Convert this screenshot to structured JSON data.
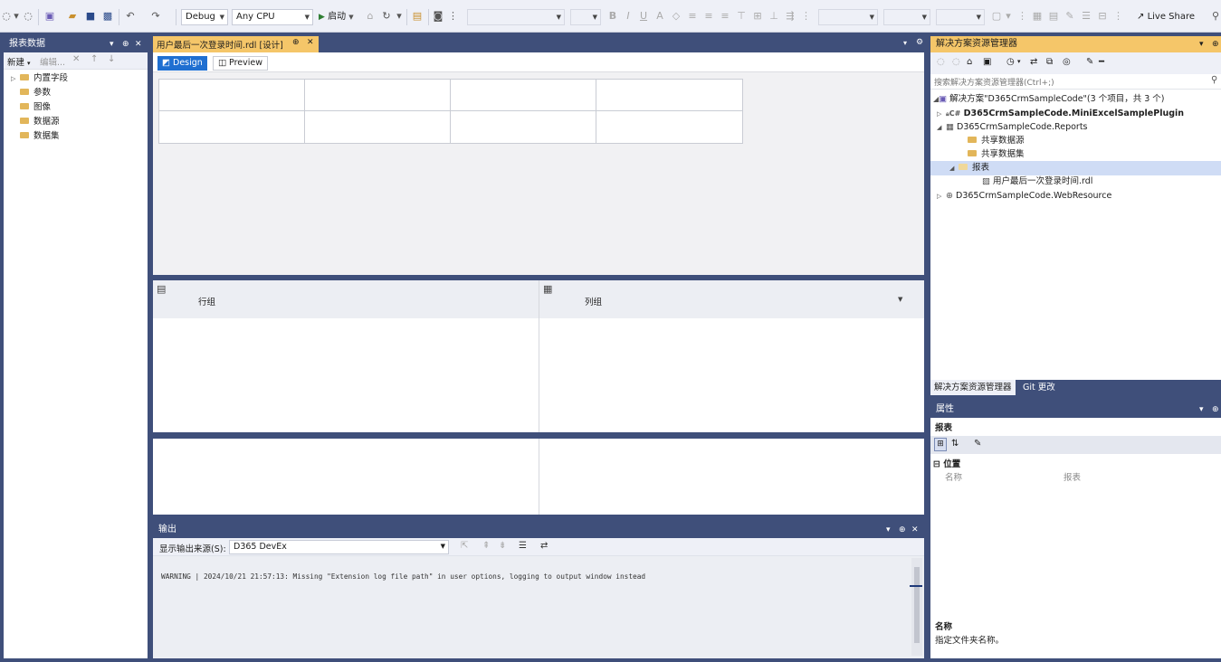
{
  "toolbar": {
    "config_value": "Debug",
    "platform_value": "Any CPU",
    "start_label": "启动",
    "live_share_label": "Live Share"
  },
  "report_data_panel": {
    "title": "报表数据",
    "new_label": "新建",
    "edit_label": "编辑...",
    "items": [
      {
        "label": "内置字段",
        "expandable": true
      },
      {
        "label": "参数",
        "expandable": false
      },
      {
        "label": "图像",
        "expandable": false
      },
      {
        "label": "数据源",
        "expandable": false
      },
      {
        "label": "数据集",
        "expandable": false
      }
    ]
  },
  "document": {
    "tab_title": "用户最后一次登录时间.rdl [设计]",
    "design_tab": "Design",
    "preview_tab": "Preview",
    "row_groups_label": "行组",
    "col_groups_label": "列组"
  },
  "output_panel": {
    "title": "输出",
    "source_label": "显示输出来源(S):",
    "source_value": "D365 DevEx",
    "log_line": "WARNING | 2024/10/21 21:57:13: Missing \"Extension log file path\" in user options, logging to output window instead"
  },
  "solution_explorer": {
    "title": "解决方案资源管理器",
    "search_placeholder": "搜索解决方案资源管理器(Ctrl+;)",
    "solution_label": "解决方案\"D365CrmSampleCode\"(3 个项目，共 3 个)",
    "project1": "D365CrmSampleCode.MiniExcelSamplePlugin",
    "project2": "D365CrmSampleCode.Reports",
    "shared_ds": "共享数据源",
    "shared_dataset": "共享数据集",
    "reports_folder": "报表",
    "report_file": "用户最后一次登录时间.rdl",
    "project3": "D365CrmSampleCode.WebResource",
    "bottom_tab_1": "解决方案资源管理器",
    "bottom_tab_2": "Git 更改"
  },
  "properties": {
    "title": "属性",
    "object_name": "报表",
    "category": "位置",
    "prop_name": "名称",
    "prop_value": "报表",
    "desc_title": "名称",
    "desc_text": "指定文件夹名称。"
  },
  "colors": {
    "chrome": "#3f4f7a",
    "active_header": "#f5c669",
    "accent": "#1f6fd1",
    "selection": "#cfdcf5"
  }
}
